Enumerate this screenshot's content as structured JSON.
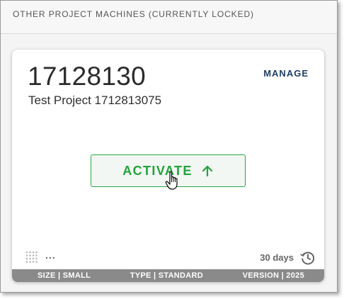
{
  "section": {
    "title": "OTHER PROJECT MACHINES (CURRENTLY LOCKED)"
  },
  "machine": {
    "number": "17128130",
    "project_name": "Test Project 1712813075",
    "manage_label": "MANAGE",
    "activate_label": "ACTIVATE",
    "more_label": "...",
    "days_label": "30 days",
    "footer": {
      "size": "SIZE | SMALL",
      "type": "TYPE | STANDARD",
      "version": "VERSION | 2025"
    }
  },
  "colors": {
    "accent_green": "#22a33b",
    "manage_blue": "#1f3f66",
    "footer_gray": "#8a8a8a"
  },
  "icons": {
    "activate": "arrow-up-icon",
    "cursor": "hand-cursor-icon",
    "grid": "grid-dots-icon",
    "history": "history-icon"
  }
}
